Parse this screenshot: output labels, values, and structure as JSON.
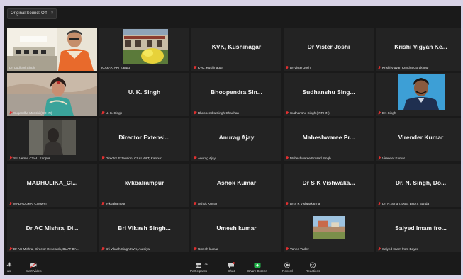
{
  "top": {
    "sound_label": "Original Sound: Off",
    "close_glyph": "×"
  },
  "tiles": [
    {
      "big": "",
      "caption": "Dr. Lodhavi Singh",
      "video": "man-office"
    },
    {
      "big": "",
      "caption": "ICAR-ATARI Kanpur",
      "video": "building"
    },
    {
      "big": "KVK, Kushinagar",
      "caption": "KVK, Kushinagar"
    },
    {
      "big": "Dr Vister Joshi",
      "caption": "Dr Vister Joshi"
    },
    {
      "big": "Krishi Vigyan Ke...",
      "caption": "Krishi Vigyan Kendra Gorakhpur"
    },
    {
      "big": "",
      "caption": "Sugandha Munshi (CO-IN)",
      "video": "woman"
    },
    {
      "big": "U. K. Singh",
      "caption": "U. K. Singh"
    },
    {
      "big": "Bhoopendra Sin...",
      "caption": "Bhoopendra Singh Chauhan"
    },
    {
      "big": "Sudhanshu Sing...",
      "caption": "Sudhanshu Singh (IRRI IN)"
    },
    {
      "big": "",
      "caption": "DK Singh",
      "video": "man-blue"
    },
    {
      "big": "",
      "caption": "S L Verma CSAU Kanpur",
      "video": "dark-room"
    },
    {
      "big": "Director Extensi...",
      "caption": "Director Extension, CSAUA&T, Kanpur"
    },
    {
      "big": "Anurag Ajay",
      "caption": "Anurag Ajay"
    },
    {
      "big": "Maheshwaree Pr...",
      "caption": "Maheshwaree Prasad Singh"
    },
    {
      "big": "Virender Kumar",
      "caption": "Virender Kumar"
    },
    {
      "big": "MADHULIKA_CI...",
      "caption": "MADHULIKA_CIMMYT"
    },
    {
      "big": "kvkbalrampur",
      "caption": "kvkbalrampur"
    },
    {
      "big": "Ashok Kumar",
      "caption": "Ashok Kumar"
    },
    {
      "big": "Dr S K Vishwaka...",
      "caption": "Dr S K Vishwakarma"
    },
    {
      "big": "Dr. N. Singh, Do...",
      "caption": "Dr. N. Singh, DoE, BUAT, Banda"
    },
    {
      "big": "Dr AC Mishra, Di...",
      "caption": "Dr AC Mishra, Director Research, BUAT BA..."
    },
    {
      "big": "Bri Vikash Singh...",
      "caption": "Bri Vikash Singh KVK, Auraiya"
    },
    {
      "big": "Umesh kumar",
      "caption": "Umesh kumar"
    },
    {
      "big": "",
      "caption": "Vanee Yadav",
      "video": "outdoor"
    },
    {
      "big": "Saiyed Imam fro...",
      "caption": "Saiyed Imam from Bayer"
    }
  ],
  "toolbar": {
    "unmute_label": "ute",
    "start_video_label": "Start Video",
    "participants_label": "Participants",
    "participants_count": "71",
    "chat_label": "Chat",
    "share_label": "Share Screen",
    "record_label": "Record",
    "reactions_label": "Reactions"
  },
  "colors": {
    "active_speaker": "#d6d62a",
    "share_green": "#22b34a",
    "mic_muted": "#e03030"
  }
}
